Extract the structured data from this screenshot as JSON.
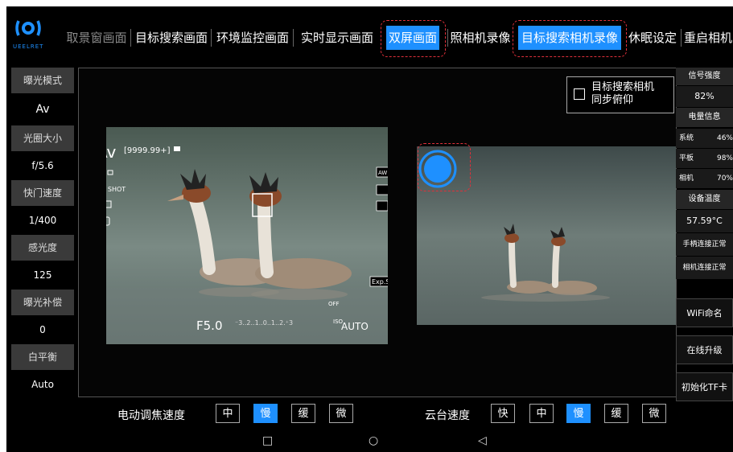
{
  "app": {
    "logo_text": "UEELRET",
    "tabs": [
      {
        "label": "取景窗画面",
        "state": "dim"
      },
      {
        "label": "目标搜索画面",
        "state": "normal"
      },
      {
        "label": "环境监控画面",
        "state": "normal"
      },
      {
        "label": "实时显示画面",
        "state": "normal"
      },
      {
        "label": "双屏画面",
        "state": "active"
      },
      {
        "label": "照相机录像",
        "state": "normal"
      },
      {
        "label": "目标搜索相机录像",
        "state": "active"
      },
      {
        "label": "休眠设定",
        "state": "normal"
      },
      {
        "label": "重启相机",
        "state": "normal"
      }
    ]
  },
  "left_panel": {
    "items": [
      {
        "label": "曝光模式",
        "value": "Av"
      },
      {
        "label": "光圈大小",
        "value": "f/5.6"
      },
      {
        "label": "快门速度",
        "value": "1/400"
      },
      {
        "label": "感光度",
        "value": "125"
      },
      {
        "label": "曝光补偿",
        "value": "0"
      },
      {
        "label": "白平衡",
        "value": "Auto"
      }
    ]
  },
  "sync": {
    "label_line1": "目标搜索相机",
    "label_line2": "同步俯仰",
    "checked": false
  },
  "camera_view": {
    "mode": "Av",
    "shots": "[9999.99+]",
    "af": "AF",
    "af_mode": "ONE SHOT",
    "awb": "AWB",
    "exp_sim": "Exp.SIM",
    "aperture": "F5.0",
    "exposure_scale": "⁻3..2..1..0..1..2.⁺3",
    "iso": "ISO",
    "iso_value": "AUTO",
    "wifi_off": "OFF"
  },
  "right_panel": {
    "signal_label": "信号强度",
    "signal_value": "82%",
    "battery_label": "电量信息",
    "battery": [
      {
        "name": "系统",
        "value": "46%"
      },
      {
        "name": "平板",
        "value": "98%"
      },
      {
        "name": "相机",
        "value": "70%"
      }
    ],
    "temp_label": "设备温度",
    "temp_value": "57.59°C",
    "status1": "手柄连接正常",
    "status2": "相机连接正常",
    "buttons": [
      "WiFi命名",
      "在线升级",
      "初始化TF卡"
    ]
  },
  "bottom": {
    "focus_label": "电动调焦速度",
    "focus_options": [
      "中",
      "慢",
      "缓",
      "微"
    ],
    "focus_selected": "慢",
    "ptz_label": "云台速度",
    "ptz_options": [
      "快",
      "中",
      "慢",
      "缓",
      "微"
    ],
    "ptz_selected": "慢"
  },
  "nav": {
    "recent": "□",
    "home": "○",
    "back": "◁"
  },
  "colors": {
    "accent": "#1e90ff",
    "highlight_dash": "#e0303a"
  }
}
